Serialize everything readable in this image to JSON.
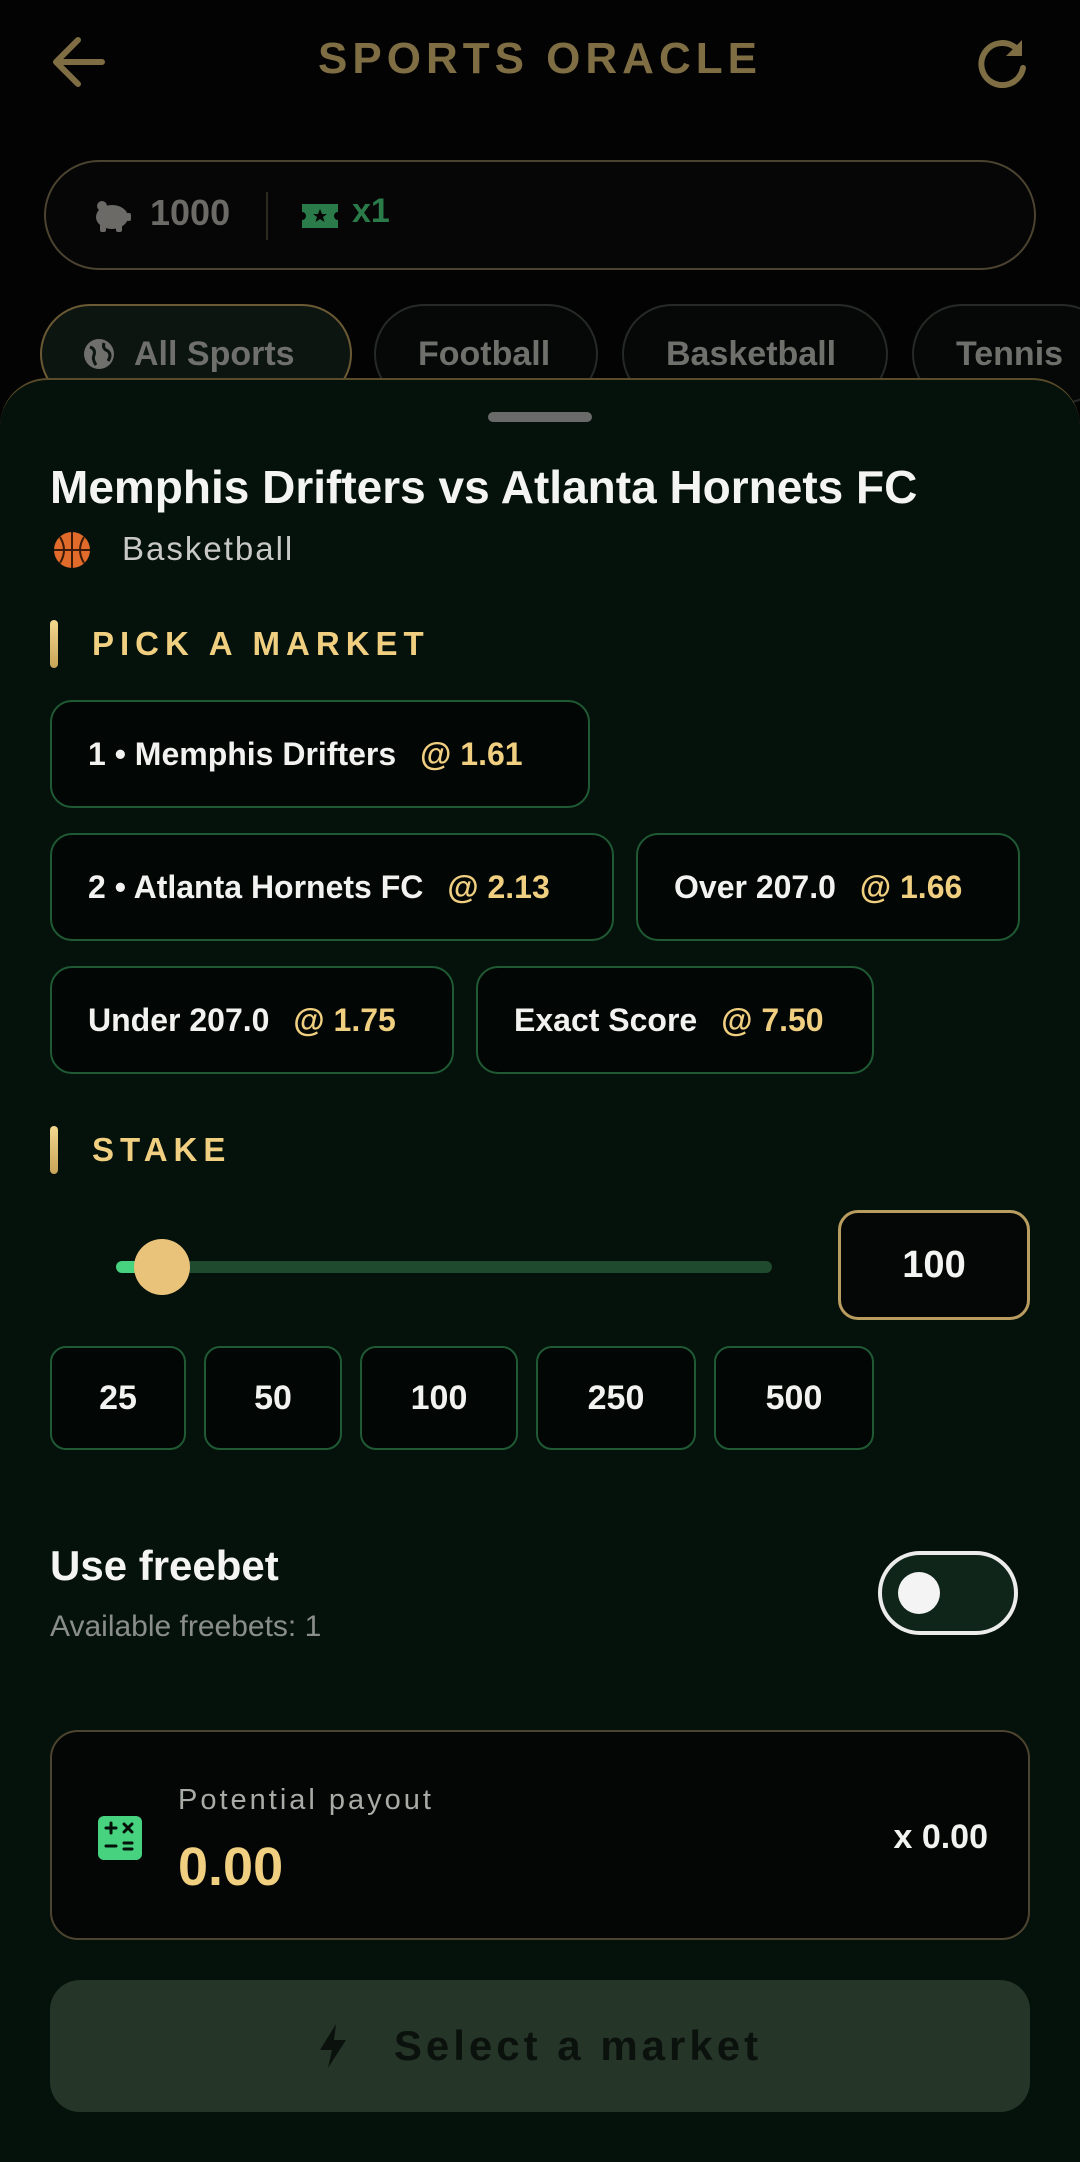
{
  "header": {
    "title": "SPORTS ORACLE",
    "back_icon": "arrow-left-icon",
    "refresh_icon": "refresh-icon"
  },
  "balance": {
    "coins": "1000",
    "coin_icon": "piggy-bank-icon",
    "tickets": "x1",
    "ticket_icon": "ticket-icon"
  },
  "sport_filters": [
    {
      "label": "All Sports",
      "active": true,
      "icon": "globe-icon"
    },
    {
      "label": "Football",
      "active": false
    },
    {
      "label": "Basketball",
      "active": false
    },
    {
      "label": "Tennis",
      "active": false
    }
  ],
  "sheet": {
    "match_title": "Memphis Drifters vs Atlanta Hornets FC",
    "sport": "Basketball",
    "sport_icon": "basketball-icon",
    "market_section": "PICK A MARKET",
    "markets": [
      {
        "label": "1 • Memphis Drifters",
        "odds": "@ 1.61"
      },
      {
        "label": "2 • Atlanta Hornets FC",
        "odds": "@ 2.13"
      },
      {
        "label": "Over 207.0",
        "odds": "@ 1.66"
      },
      {
        "label": "Under 207.0",
        "odds": "@ 1.75"
      },
      {
        "label": "Exact Score",
        "odds": "@ 7.50"
      }
    ],
    "stake_section": "STAKE",
    "stake": {
      "value": "100",
      "slider_fraction": 0.07
    },
    "quick_stakes": [
      "25",
      "50",
      "100",
      "250",
      "500"
    ],
    "freebet": {
      "title": "Use freebet",
      "subtitle": "Available freebets: 1",
      "enabled": false
    },
    "payout": {
      "label": "Potential payout",
      "value": "0.00",
      "multiplier": "x 0.00",
      "icon": "calculator-icon"
    },
    "cta": {
      "label": "Select a market",
      "icon": "bolt-icon"
    }
  },
  "colors": {
    "gold": "#f0cf81",
    "green_accent": "#46d27f",
    "sheet_bg": "#05110b",
    "market_border": "#1f5a34"
  }
}
